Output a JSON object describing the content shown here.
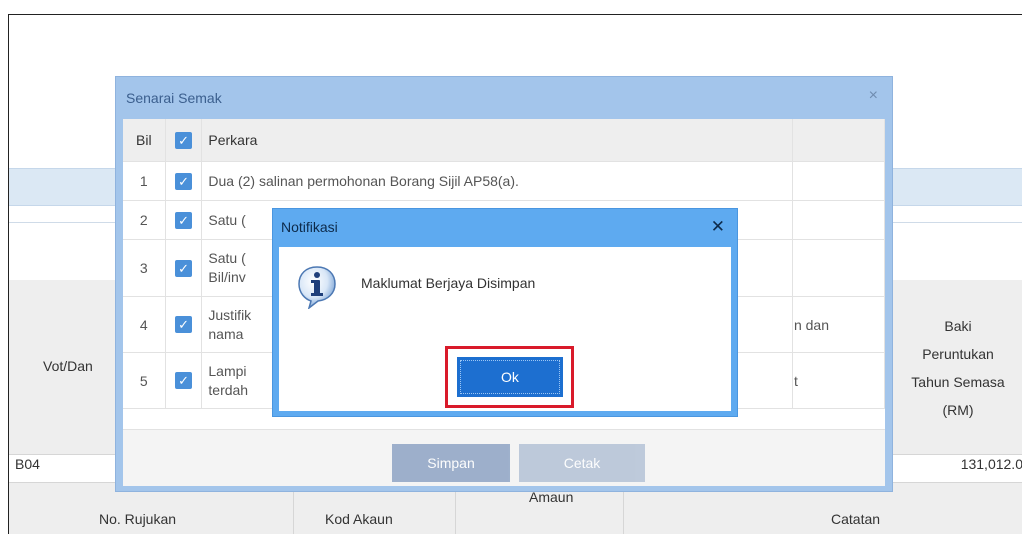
{
  "background": {
    "vot_label": "Vot/Dan",
    "baki_lines": [
      "Baki",
      "Peruntukan",
      "Tahun Semasa",
      "(RM)"
    ],
    "row_code": "B04",
    "row_value": "131,012.0",
    "bottom_headers": [
      "No. Rujukan",
      "Kod Akaun",
      "Amaun",
      "Catatan"
    ]
  },
  "senarai_dialog": {
    "title": "Senarai Semak",
    "close_glyph": "×",
    "header": {
      "bil": "Bil",
      "perkara": "Perkara"
    },
    "rows": [
      {
        "bil": "1",
        "text": "Dua (2) salinan permohonan Borang Sijil AP58(a).",
        "tail": ""
      },
      {
        "bil": "2",
        "text": "Satu (",
        "tail": ""
      },
      {
        "bil": "3",
        "text": "Satu (",
        "text2": "Bil/inv",
        "tail": ""
      },
      {
        "bil": "4",
        "text": "Justifik",
        "text2": "nama",
        "tail": "n dan"
      },
      {
        "bil": "5",
        "text": "Lampi",
        "text2": "terdah",
        "tail": "t"
      }
    ],
    "simpan_label": "Simpan",
    "cetak_label": "Cetak"
  },
  "notification": {
    "title": "Notifikasi",
    "close_glyph": "✕",
    "message": "Maklumat Berjaya Disimpan",
    "ok_label": "Ok",
    "icon": "info-icon"
  },
  "colors": {
    "dialog_header": "#a3c5eb",
    "notif_header": "#5eaaf0",
    "ok_button": "#1d6fd0",
    "highlight": "#d91a2a",
    "checkbox": "#4a90d9"
  }
}
